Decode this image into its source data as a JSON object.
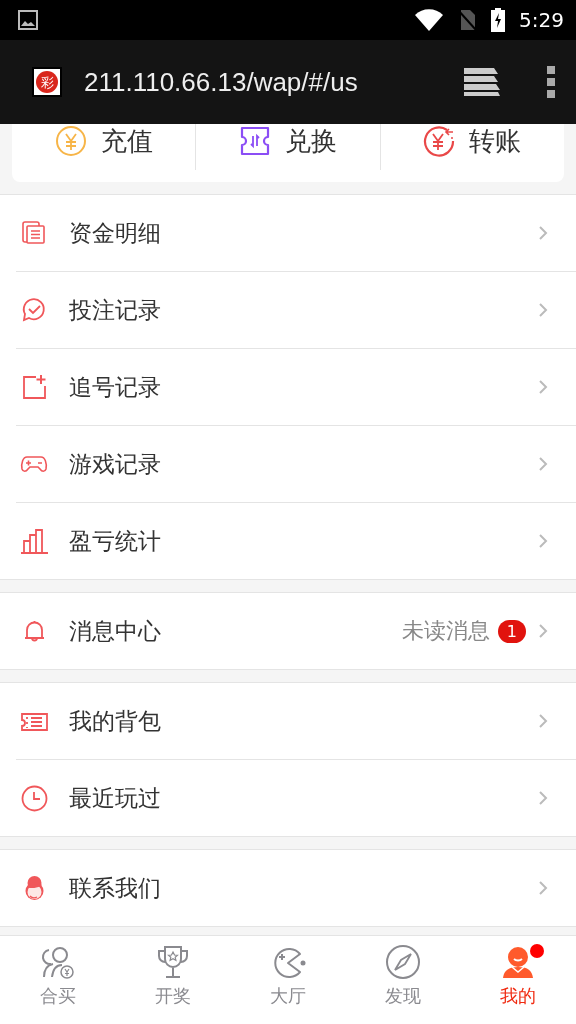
{
  "status_bar": {
    "time": "5:29"
  },
  "browser": {
    "logo_text": "彩",
    "url": "211.110.66.13/wap/#/us"
  },
  "quick_actions": [
    {
      "label": "充值"
    },
    {
      "label": "兑换"
    },
    {
      "label": "转账"
    }
  ],
  "menu_groups": [
    {
      "items": [
        {
          "label": "资金明细"
        },
        {
          "label": "投注记录"
        },
        {
          "label": "追号记录"
        },
        {
          "label": "游戏记录"
        },
        {
          "label": "盈亏统计"
        }
      ]
    },
    {
      "items": [
        {
          "label": "消息中心",
          "note": "未读消息",
          "badge": "1"
        }
      ]
    },
    {
      "items": [
        {
          "label": "我的背包"
        },
        {
          "label": "最近玩过"
        }
      ]
    },
    {
      "items": [
        {
          "label": "联系我们"
        }
      ]
    }
  ],
  "tab_bar": [
    {
      "label": "合买",
      "selected": false,
      "dot": false
    },
    {
      "label": "开奖",
      "selected": false,
      "dot": false
    },
    {
      "label": "大厅",
      "selected": false,
      "dot": false
    },
    {
      "label": "发现",
      "selected": false,
      "dot": false
    },
    {
      "label": "我的",
      "selected": true,
      "dot": true
    }
  ]
}
